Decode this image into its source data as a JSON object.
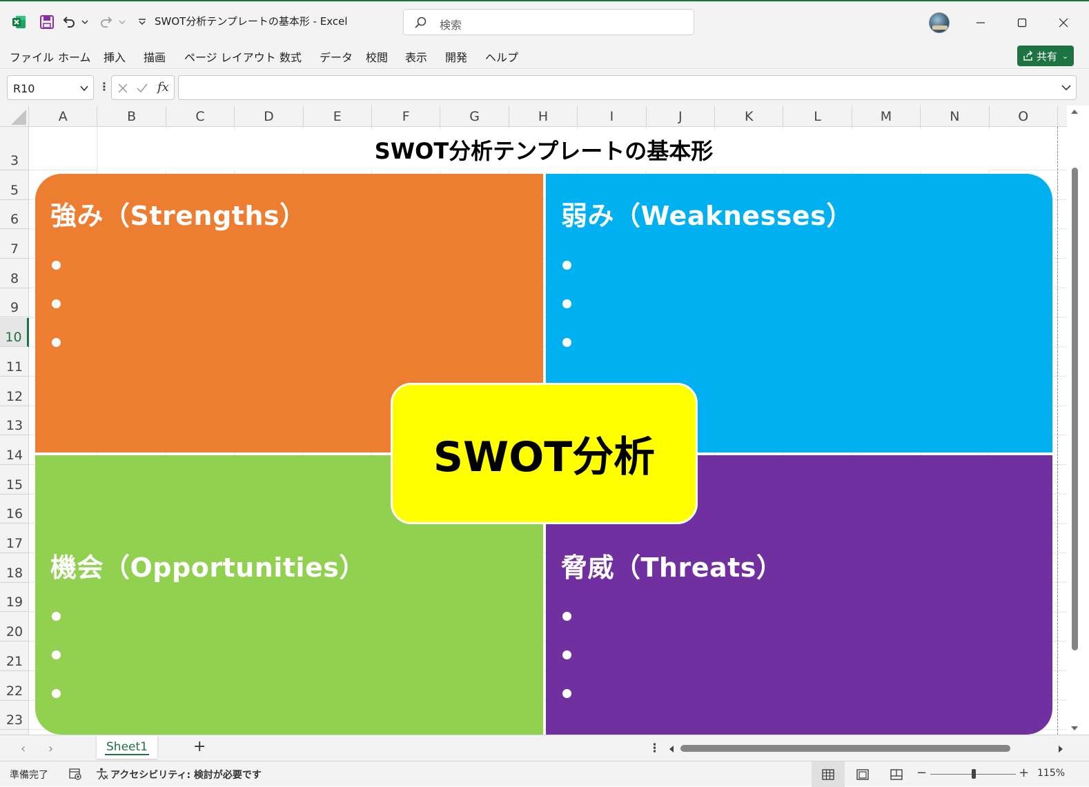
{
  "app": {
    "document_title": "SWOT分析テンプレートの基本形  -  Excel",
    "search_placeholder": "検索",
    "accent_color": "#1e7145"
  },
  "ribbon": {
    "tabs": [
      "ファイル",
      "ホーム",
      "挿入",
      "描画",
      "ページ レイアウト",
      "数式",
      "データ",
      "校閲",
      "表示",
      "開発",
      "ヘルプ"
    ],
    "share_label": "共有"
  },
  "formula_bar": {
    "name_box": "R10",
    "fx_label": "fx",
    "formula": ""
  },
  "grid": {
    "columns": [
      "A",
      "B",
      "C",
      "D",
      "E",
      "F",
      "G",
      "H",
      "I",
      "J",
      "K",
      "L",
      "M",
      "N",
      "O"
    ],
    "rows": [
      "3",
      "5",
      "6",
      "7",
      "8",
      "9",
      "10",
      "11",
      "12",
      "13",
      "14",
      "15",
      "16",
      "17",
      "18",
      "19",
      "20",
      "21",
      "22",
      "23"
    ],
    "active_row": "10"
  },
  "sheet_content": {
    "title": "SWOT分析テンプレートの基本形",
    "center_label": "SWOT分析",
    "quadrants": {
      "strengths": {
        "title": "強み（Strengths）",
        "color": "#ed7d31",
        "bullets": 3
      },
      "weaknesses": {
        "title": "弱み（Weaknesses）",
        "color": "#00b0f0",
        "bullets": 3
      },
      "opportunities": {
        "title": "機会（Opportunities）",
        "color": "#92d050",
        "bullets": 3
      },
      "threats": {
        "title": "脅威（Threats）",
        "color": "#7030a0",
        "bullets": 3
      }
    },
    "center_color": "#ffff00"
  },
  "sheet_tabs": {
    "tabs": [
      "Sheet1"
    ],
    "add_label": "+"
  },
  "status_bar": {
    "ready": "準備完了",
    "accessibility": "アクセシビリティ: 検討が必要です",
    "zoom": "115%"
  }
}
